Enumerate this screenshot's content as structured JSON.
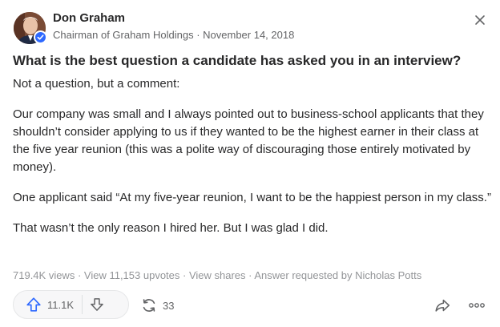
{
  "author": {
    "name": "Don Graham",
    "credential": "Chairman of Graham Holdings",
    "separator": " · ",
    "date": "November 14, 2018",
    "avatar_icon": "user-photo",
    "verified_icon": "check-badge-icon"
  },
  "question": "What is the best question a candidate has asked you in an interview?",
  "answer": {
    "paragraphs": [
      "Not a question, but a comment:",
      "Our company was small and I always pointed out to business-school applicants that they shouldn’t consider applying to us if they wanted to be the highest earner in their class at the five year reunion (this was a polite way of discouraging those entirely motivated by money).",
      "One applicant said “At my five-year reunion, I want to be the happiest person in my class.”",
      "That wasn’t the only reason I hired her. But I was glad I did."
    ]
  },
  "stats": {
    "views": "719.4K views",
    "sep": " · ",
    "upvotes_link": "View 11,153 upvotes",
    "shares_link": "View shares",
    "requested": "Answer requested by Nicholas Potts"
  },
  "actions": {
    "upvote_count": "11.1K",
    "share_count": "33"
  },
  "colors": {
    "accent": "#2e69ff",
    "text": "#282829",
    "muted": "#636466"
  }
}
